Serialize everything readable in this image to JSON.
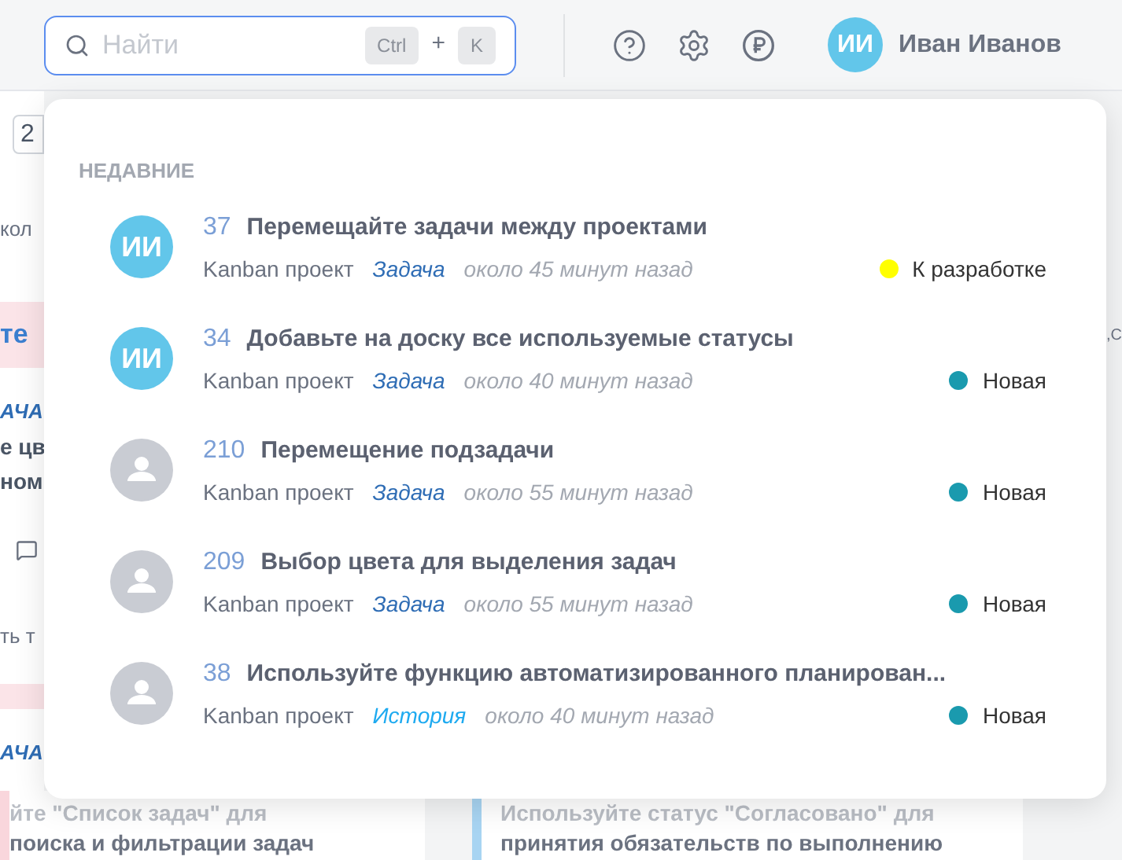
{
  "search": {
    "placeholder": "Найти",
    "shortcut": [
      "Ctrl",
      "+",
      "K"
    ]
  },
  "user": {
    "initials": "ИИ",
    "name": "Иван Иванов"
  },
  "background": {
    "left_fragments": [
      {
        "kind": "box",
        "text": "2"
      },
      {
        "kind": "plain",
        "text": "кол"
      },
      {
        "kind": "title",
        "text": "те"
      },
      {
        "kind": "type",
        "text": "АЧА"
      },
      {
        "kind": "bold",
        "text": "е цв"
      },
      {
        "kind": "bold",
        "text": "ном"
      },
      {
        "kind": "comment"
      },
      {
        "kind": "plain",
        "text": "ть т"
      },
      {
        "kind": "bar"
      },
      {
        "kind": "type",
        "text": "АЧА"
      }
    ],
    "right_fragment": ",С",
    "bottom_cards": [
      {
        "lines": [
          "йте \"Список задач\" для",
          "поиска и фильтрации задач"
        ],
        "color": "#f9d6dc"
      },
      {
        "lines": [
          "Используйте статус \"Согласовано\" для",
          "принятия обязательств по выполнению"
        ],
        "color": "#a8d4f2"
      }
    ]
  },
  "recent": {
    "heading": "НЕДАВНИЕ",
    "items": [
      {
        "initials": "ИИ",
        "number": "37",
        "title": "Перемещайте задачи между проектами",
        "project": "Kanban проект",
        "type": "Задача",
        "kind": "task",
        "time": "около 45 минут назад",
        "status": "К разработке",
        "color": "#ffff00"
      },
      {
        "initials": "ИИ",
        "number": "34",
        "title": "Добавьте на доску все используемые статусы",
        "project": "Kanban проект",
        "type": "Задача",
        "kind": "task",
        "time": "около 40 минут назад",
        "status": "Новая",
        "color": "#1a9aae"
      },
      {
        "number": "210",
        "title": "Перемещение подзадачи",
        "project": "Kanban проект",
        "type": "Задача",
        "kind": "task",
        "time": "около 55 минут назад",
        "status": "Новая",
        "color": "#1a9aae"
      },
      {
        "number": "209",
        "title": "Выбор цвета для выделения задач",
        "project": "Kanban проект",
        "type": "Задача",
        "kind": "task",
        "time": "около 55 минут назад",
        "status": "Новая",
        "color": "#1a9aae"
      },
      {
        "number": "38",
        "title": "Используйте функцию автоматизированного планирован...",
        "project": "Kanban проект",
        "type": "История",
        "kind": "story",
        "time": "около 40 минут назад",
        "status": "Новая",
        "color": "#1a9aae"
      }
    ]
  }
}
